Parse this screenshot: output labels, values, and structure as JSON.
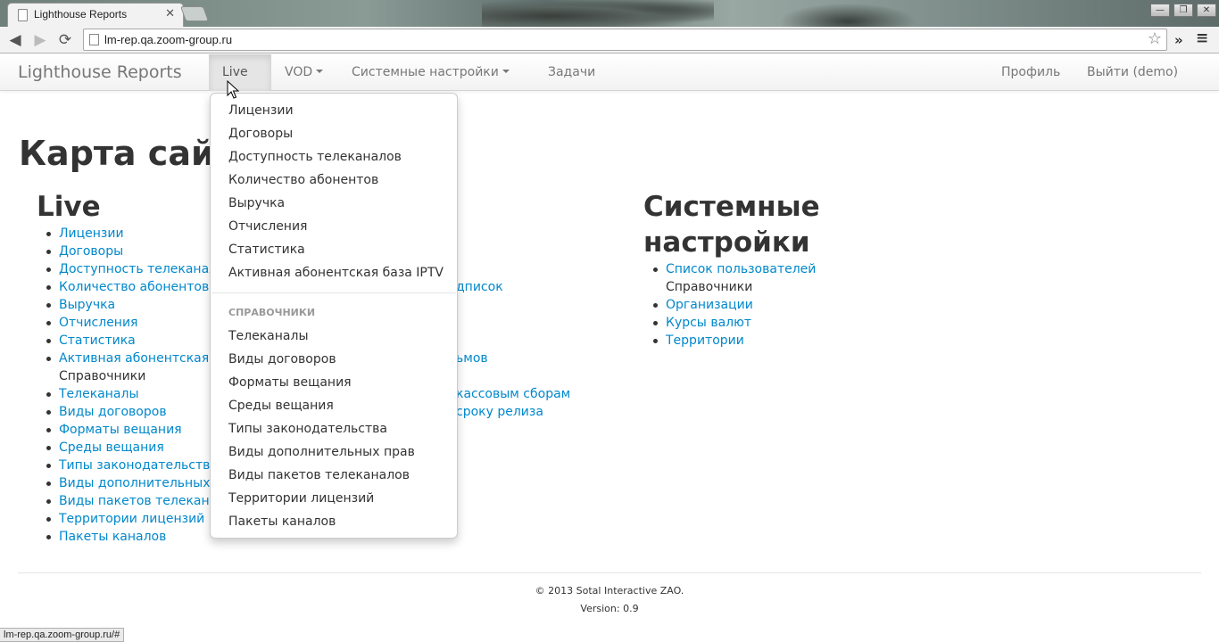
{
  "browser": {
    "tab_title": "Lighthouse Reports",
    "tab_close": "✕",
    "url": "lm-rep.qa.zoom-group.ru",
    "status_url": "lm-rep.qa.zoom-group.ru/#",
    "window_controls": [
      "—",
      "❐",
      "✕"
    ]
  },
  "navbar": {
    "brand": "Lighthouse Reports",
    "items": [
      {
        "label": "Live",
        "has_caret": true,
        "active": true
      },
      {
        "label": "VOD",
        "has_caret": true
      },
      {
        "label": "Системные настройки",
        "has_caret": true
      },
      {
        "label": "Задачи"
      }
    ],
    "right": [
      {
        "label": "Профиль"
      },
      {
        "label": "Выйти (demo)"
      }
    ]
  },
  "page": {
    "title": "Карта сайта",
    "live": {
      "heading": "Live",
      "items": [
        {
          "text": "Лицензии",
          "link": true
        },
        {
          "text": "Договоры",
          "link": true
        },
        {
          "text": "Доступность телеканалов",
          "link": true
        },
        {
          "text": "Количество абонентов",
          "link": true
        },
        {
          "text": "Выручка",
          "link": true
        },
        {
          "text": "Отчисления",
          "link": true
        },
        {
          "text": "Статистика",
          "link": true
        },
        {
          "text": "Активная абонентская база IPTV",
          "link": true
        },
        {
          "text": "Справочники",
          "link": false
        },
        {
          "text": "Телеканалы",
          "link": true
        },
        {
          "text": "Виды договоров",
          "link": true
        },
        {
          "text": "Форматы вещания",
          "link": true
        },
        {
          "text": "Среды вещания",
          "link": true
        },
        {
          "text": "Типы законодательства",
          "link": true
        },
        {
          "text": "Виды дополнительных прав",
          "link": true
        },
        {
          "text": "Виды пакетов телеканалов",
          "link": true
        },
        {
          "text": "Территории лицензий",
          "link": true
        },
        {
          "text": "Пакеты каналов",
          "link": true
        }
      ]
    },
    "vod_visible": [
      {
        "text": "дписок",
        "row": 3
      },
      {
        "text": "ьмов",
        "row": 7
      },
      {
        "text": "кассовым сборам",
        "row": 9
      },
      {
        "text": "сроку релиза",
        "row": 10
      }
    ],
    "system": {
      "heading_line1": "Системные",
      "heading_line2": "настройки",
      "items": [
        {
          "text": "Список пользователей",
          "link": true
        },
        {
          "text": "Справочники",
          "link": false
        },
        {
          "text": "Организации",
          "link": true
        },
        {
          "text": "Курсы валют",
          "link": true
        },
        {
          "text": "Территории",
          "link": true
        }
      ]
    },
    "footer": {
      "copyright": "© 2013 Sotal Interactive ZAO.",
      "version": "Version: 0.9"
    }
  },
  "dropdown": {
    "items_top": [
      "Лицензии",
      "Договоры",
      "Доступность телеканалов",
      "Количество абонентов",
      "Выручка",
      "Отчисления",
      "Статистика",
      "Активная абонентская база IPTV"
    ],
    "header": "Справочники",
    "items_bottom": [
      "Телеканалы",
      "Виды договоров",
      "Форматы вещания",
      "Среды вещания",
      "Типы законодательства",
      "Виды дополнительных прав",
      "Виды пакетов телеканалов",
      "Территории лицензий",
      "Пакеты каналов"
    ]
  },
  "colors": {
    "link": "#0088cc",
    "text": "#333333",
    "navbar_text": "#777777"
  }
}
